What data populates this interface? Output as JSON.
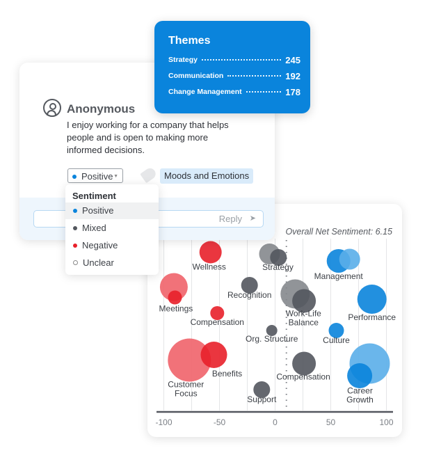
{
  "themes": {
    "title": "Themes",
    "items": [
      {
        "label": "Strategy",
        "count": "245"
      },
      {
        "label": "Communication",
        "count": "192"
      },
      {
        "label": "Change Management",
        "count": "178"
      }
    ]
  },
  "comment": {
    "author": "Anonymous",
    "text": "I enjoy working for a company that helps people and is open to making more informed decisions.",
    "sentiment_value": "Positive",
    "tag": "Moods and Emotions",
    "reply_placeholder": "Reply"
  },
  "sentiment_dropdown": {
    "title": "Sentiment",
    "selected": "Positive",
    "options": [
      {
        "label": "Positive",
        "color": "#0a84dc"
      },
      {
        "label": "Mixed",
        "color": "#53575e"
      },
      {
        "label": "Negative",
        "color": "#e8202a"
      },
      {
        "label": "Unclear",
        "color": "#ffffff"
      }
    ]
  },
  "colors": {
    "negative": "#e8202a",
    "negative_light": "#f0636a",
    "mixed": "#53575e",
    "mixed_light": "#85888d",
    "positive": "#0a84dc",
    "positive_light": "#5aaee9",
    "accent": "#0a84dc"
  },
  "chart_data": {
    "type": "scatter",
    "subtype": "bubble",
    "annotation": "Overall Net Sentiment: 6.15",
    "net_sentiment": 6.15,
    "xlim": [
      -100,
      100
    ],
    "x_ticks": [
      "-100",
      "-50",
      "0",
      "50",
      "100"
    ],
    "grid": "vertical",
    "points": [
      {
        "label": "Wellness",
        "x": -58,
        "y": 91,
        "size": 16,
        "color": "#e8202a"
      },
      {
        "label": "Strategy",
        "x": -5,
        "y": 90,
        "size": 15,
        "color": "#85888d"
      },
      {
        "label": "",
        "x": 3,
        "y": 88,
        "size": 12,
        "color": "#53575e"
      },
      {
        "label": "Management",
        "x": 57,
        "y": 86,
        "size": 17,
        "color": "#0a84dc"
      },
      {
        "label": "",
        "x": 67,
        "y": 87,
        "size": 15,
        "color": "#5aaee9"
      },
      {
        "label": "Meetings",
        "x": -91,
        "y": 71,
        "size": 20,
        "color": "#f0636a"
      },
      {
        "label": "",
        "x": -90,
        "y": 65,
        "size": 10,
        "color": "#e8202a"
      },
      {
        "label": "Recognition",
        "x": -23,
        "y": 72,
        "size": 12,
        "color": "#53575e"
      },
      {
        "label": "Work-Life Balance",
        "x": 18,
        "y": 67,
        "size": 21,
        "color": "#85888d"
      },
      {
        "label": "",
        "x": 26,
        "y": 63,
        "size": 17,
        "color": "#53575e"
      },
      {
        "label": "Performance",
        "x": 87,
        "y": 64,
        "size": 21,
        "color": "#0a84dc"
      },
      {
        "label": "Compensation",
        "x": -52,
        "y": 56,
        "size": 10,
        "color": "#e8202a"
      },
      {
        "label": "Org. Structure",
        "x": -3,
        "y": 46,
        "size": 8,
        "color": "#53575e"
      },
      {
        "label": "Culture",
        "x": 55,
        "y": 46,
        "size": 11,
        "color": "#0a84dc"
      },
      {
        "label": "Customer Focus",
        "x": -77,
        "y": 29,
        "size": 31,
        "color": "#f0636a"
      },
      {
        "label": "Benefits",
        "x": -55,
        "y": 32,
        "size": 19,
        "color": "#e8202a"
      },
      {
        "label": "Compensation",
        "x": 26,
        "y": 27,
        "size": 17,
        "color": "#53575e"
      },
      {
        "label": "Career Growth",
        "x": 85,
        "y": 27,
        "size": 29,
        "color": "#5aaee9"
      },
      {
        "label": "",
        "x": 76,
        "y": 20,
        "size": 18,
        "color": "#0a84dc"
      },
      {
        "label": "Support",
        "x": -12,
        "y": 12,
        "size": 12,
        "color": "#53575e"
      }
    ]
  }
}
